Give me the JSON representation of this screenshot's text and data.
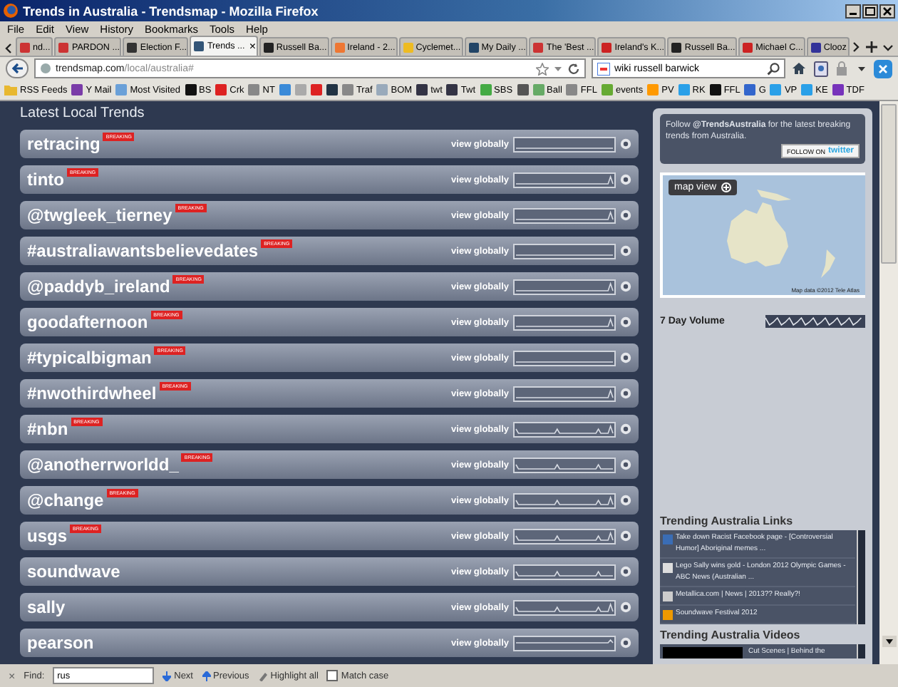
{
  "window": {
    "title": "Trends in Australia - Trendsmap - Mozilla Firefox"
  },
  "menu": [
    "File",
    "Edit",
    "View",
    "History",
    "Bookmarks",
    "Tools",
    "Help"
  ],
  "tabs": [
    {
      "label": "nd...",
      "selected": false
    },
    {
      "label": "PARDON ...",
      "selected": false
    },
    {
      "label": "Election F...",
      "selected": false
    },
    {
      "label": "Trends ...",
      "selected": true,
      "close": "×"
    },
    {
      "label": "Russell Ba...",
      "selected": false
    },
    {
      "label": "Ireland - 2...",
      "selected": false
    },
    {
      "label": "Cyclemet...",
      "selected": false
    },
    {
      "label": "My Daily ...",
      "selected": false
    },
    {
      "label": "The 'Best ...",
      "selected": false
    },
    {
      "label": "Ireland's K...",
      "selected": false
    },
    {
      "label": "Russell Ba...",
      "selected": false
    },
    {
      "label": "Michael C...",
      "selected": false
    },
    {
      "label": "Clooz",
      "selected": false
    }
  ],
  "address_bar": {
    "host": "trendsmap.com",
    "path": "/local/australia#"
  },
  "search": {
    "value": "wiki russell barwick"
  },
  "bookmarks": [
    {
      "kind": "folder",
      "label": "RSS Feeds"
    },
    {
      "kind": "link",
      "label": "Y Mail"
    },
    {
      "kind": "link",
      "label": "Most Visited"
    },
    {
      "kind": "link",
      "label": "BS"
    },
    {
      "kind": "link",
      "label": "Crk"
    },
    {
      "kind": "link",
      "label": "NT"
    },
    {
      "kind": "icon"
    },
    {
      "kind": "icon"
    },
    {
      "kind": "icon"
    },
    {
      "kind": "icon"
    },
    {
      "kind": "link",
      "label": "Traf"
    },
    {
      "kind": "link",
      "label": "BOM"
    },
    {
      "kind": "link",
      "label": "twt"
    },
    {
      "kind": "link",
      "label": "Twt"
    },
    {
      "kind": "link",
      "label": "SBS"
    },
    {
      "kind": "icon"
    },
    {
      "kind": "link",
      "label": "Ball"
    },
    {
      "kind": "link",
      "label": "FFL"
    },
    {
      "kind": "link",
      "label": "events"
    },
    {
      "kind": "link",
      "label": "PV"
    },
    {
      "kind": "link",
      "label": "RK"
    },
    {
      "kind": "link",
      "label": "FFL"
    },
    {
      "kind": "link",
      "label": "G"
    },
    {
      "kind": "link",
      "label": "VP"
    },
    {
      "kind": "link",
      "label": "KE"
    },
    {
      "kind": "link",
      "label": "TDF"
    }
  ],
  "trends": {
    "heading": "Latest Local Trends",
    "rows": [
      {
        "name": "retracing",
        "badge": "BREAKING",
        "link": "view globally"
      },
      {
        "name": "tinto",
        "badge": "BREAKING",
        "link": "view globally"
      },
      {
        "name": "@twgleek_tierney",
        "badge": "BREAKING",
        "link": "view globally"
      },
      {
        "name": "#australiawantsbelievedates",
        "badge": "BREAKING",
        "link": "view globally"
      },
      {
        "name": "@paddyb_ireland",
        "badge": "BREAKING",
        "link": "view globally"
      },
      {
        "name": "goodafternoon",
        "badge": "BREAKING",
        "link": "view globally"
      },
      {
        "name": "#typicalbigman",
        "badge": "BREAKING",
        "link": "view globally"
      },
      {
        "name": "#nwothirdwheel",
        "badge": "BREAKING",
        "link": "view globally"
      },
      {
        "name": "#nbn",
        "badge": "BREAKING",
        "link": "view globally"
      },
      {
        "name": "@anotherrworldd_",
        "badge": "BREAKING",
        "link": "view globally"
      },
      {
        "name": "@change",
        "badge": "BREAKING",
        "link": "view globally"
      },
      {
        "name": "usgs",
        "badge": "BREAKING",
        "link": "view globally"
      },
      {
        "name": "soundwave",
        "link": "view globally"
      },
      {
        "name": "sally",
        "link": "view globally"
      },
      {
        "name": "pearson",
        "link": "view globally"
      }
    ]
  },
  "sidebar": {
    "follow": {
      "text": "Follow **@TrendsAustralia** for the latest breaking trends from Australia.",
      "button_prefix": "FOLLOW ON",
      "button_brand": "twitter"
    },
    "map": {
      "button": "map view",
      "attribution": "Map data ©2012 Tele Atlas"
    },
    "volume": {
      "label": "7 Day Volume"
    },
    "links": {
      "heading": "Trending Australia Links",
      "items": [
        {
          "title": "Take down Racist Facebook page - [Controversial Humor] Aboriginal memes ..."
        },
        {
          "title": "Lego Sally wins gold - London 2012 Olympic Games - ABC News (Australian ..."
        },
        {
          "title": "Metallica.com | News | 2013?? Really?!"
        },
        {
          "title": "Soundwave Festival 2012"
        }
      ]
    },
    "videos": {
      "heading": "Trending Australia Videos",
      "items": [
        {
          "title": "Cut Scenes | Behind the"
        }
      ]
    }
  },
  "find_bar": {
    "close": "×",
    "label": "Find:",
    "value": "rus",
    "next": "Next",
    "previous": "Previous",
    "highlight": "Highlight all",
    "match_case": {
      "label": "Match case",
      "checked": false
    }
  }
}
